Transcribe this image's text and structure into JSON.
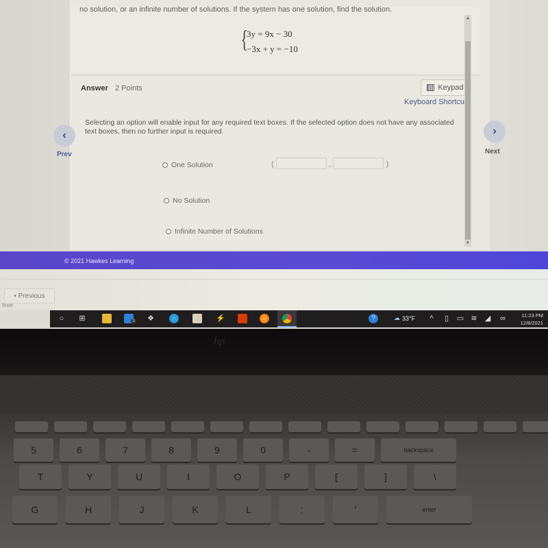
{
  "question": {
    "text_fragment": "no solution, or an infinite number of solutions. If the system has one solution, find the solution.",
    "equations": [
      "3y = 9x − 30",
      "−3x + y = −10"
    ]
  },
  "answer": {
    "label": "Answer",
    "points": "2 Points",
    "keypad_label": "Keypad",
    "keyboard_shortcuts_label": "Keyboard Shortcuts",
    "instructions": "Selecting an option will enable input for any required text boxes. If the selected option does not have any associated text boxes, then no further input is required.",
    "options": [
      {
        "label": "One Solution",
        "selected": false
      },
      {
        "label": "No Solution",
        "selected": false
      },
      {
        "label": "Infinite Number of Solutions",
        "selected": false
      }
    ],
    "coordinate": {
      "open": "(",
      "separator": ",",
      "close": ")",
      "x_value": "",
      "y_value": ""
    }
  },
  "navigation": {
    "prev_label": "Prev",
    "next_label": "Next",
    "prev_glyph": "‹",
    "next_glyph": "›"
  },
  "footer": {
    "copyright": "© 2021 Hawkes Learning",
    "previous_button": "• Previous",
    "test_label": "Test#"
  },
  "taskbar": {
    "icons": [
      "search-icon",
      "task-view-icon",
      "file-explorer-icon",
      "mail-icon",
      "dropbox-icon",
      "edge-icon",
      "store-icon",
      "app-icon",
      "office-icon",
      "firefox-icon",
      "chrome-icon"
    ],
    "mail_badge": "3",
    "weather": "33°F",
    "time": "11:23 PM",
    "date": "12/8/2021"
  },
  "laptop": {
    "brand": "hp",
    "keys_row_numbers": [
      "5",
      "6",
      "7",
      "8",
      "9",
      "0",
      "-",
      "=",
      "backspace"
    ],
    "keys_row_top": [
      "T",
      "Y",
      "U",
      "I",
      "O",
      "P",
      "[",
      "]",
      "\\"
    ],
    "keys_row_home": [
      "G",
      "H",
      "J",
      "K",
      "L",
      ";",
      "'",
      "enter"
    ]
  }
}
